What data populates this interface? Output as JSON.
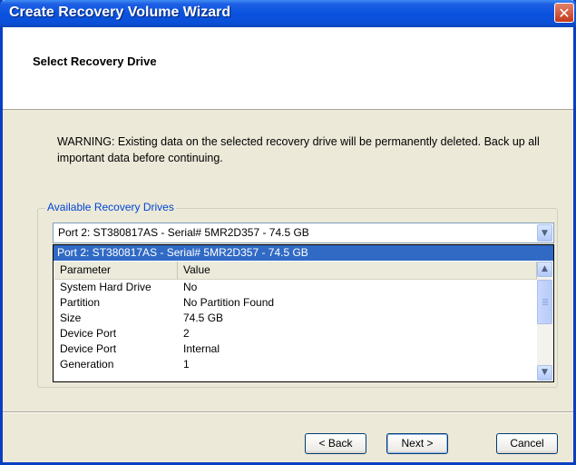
{
  "window": {
    "title": "Create Recovery Volume Wizard",
    "close_glyph": "✕"
  },
  "header": {
    "title": "Select Recovery Drive"
  },
  "warning": "WARNING: Existing data on the selected recovery drive will be permanently deleted. Back up all important data before continuing.",
  "group": {
    "label": "Available Recovery Drives",
    "combo_value": "Port 2: ST380817AS - Serial# 5MR2D357 - 74.5 GB",
    "dropdown_selected": "Port 2: ST380817AS - Serial# 5MR2D357 - 74.5 GB",
    "columns": [
      "Parameter",
      "Value"
    ],
    "rows": [
      [
        "System Hard Drive",
        "No"
      ],
      [
        "Partition",
        "No Partition Found"
      ],
      [
        "Size",
        "74.5 GB"
      ],
      [
        "Device Port",
        "2"
      ],
      [
        "Device Port",
        "Internal"
      ],
      [
        "Generation",
        "1"
      ]
    ]
  },
  "buttons": {
    "back": "< Back",
    "next": "Next >",
    "cancel": "Cancel"
  },
  "icons": {
    "close": "close-icon",
    "combo": "chevron-down-icon"
  }
}
